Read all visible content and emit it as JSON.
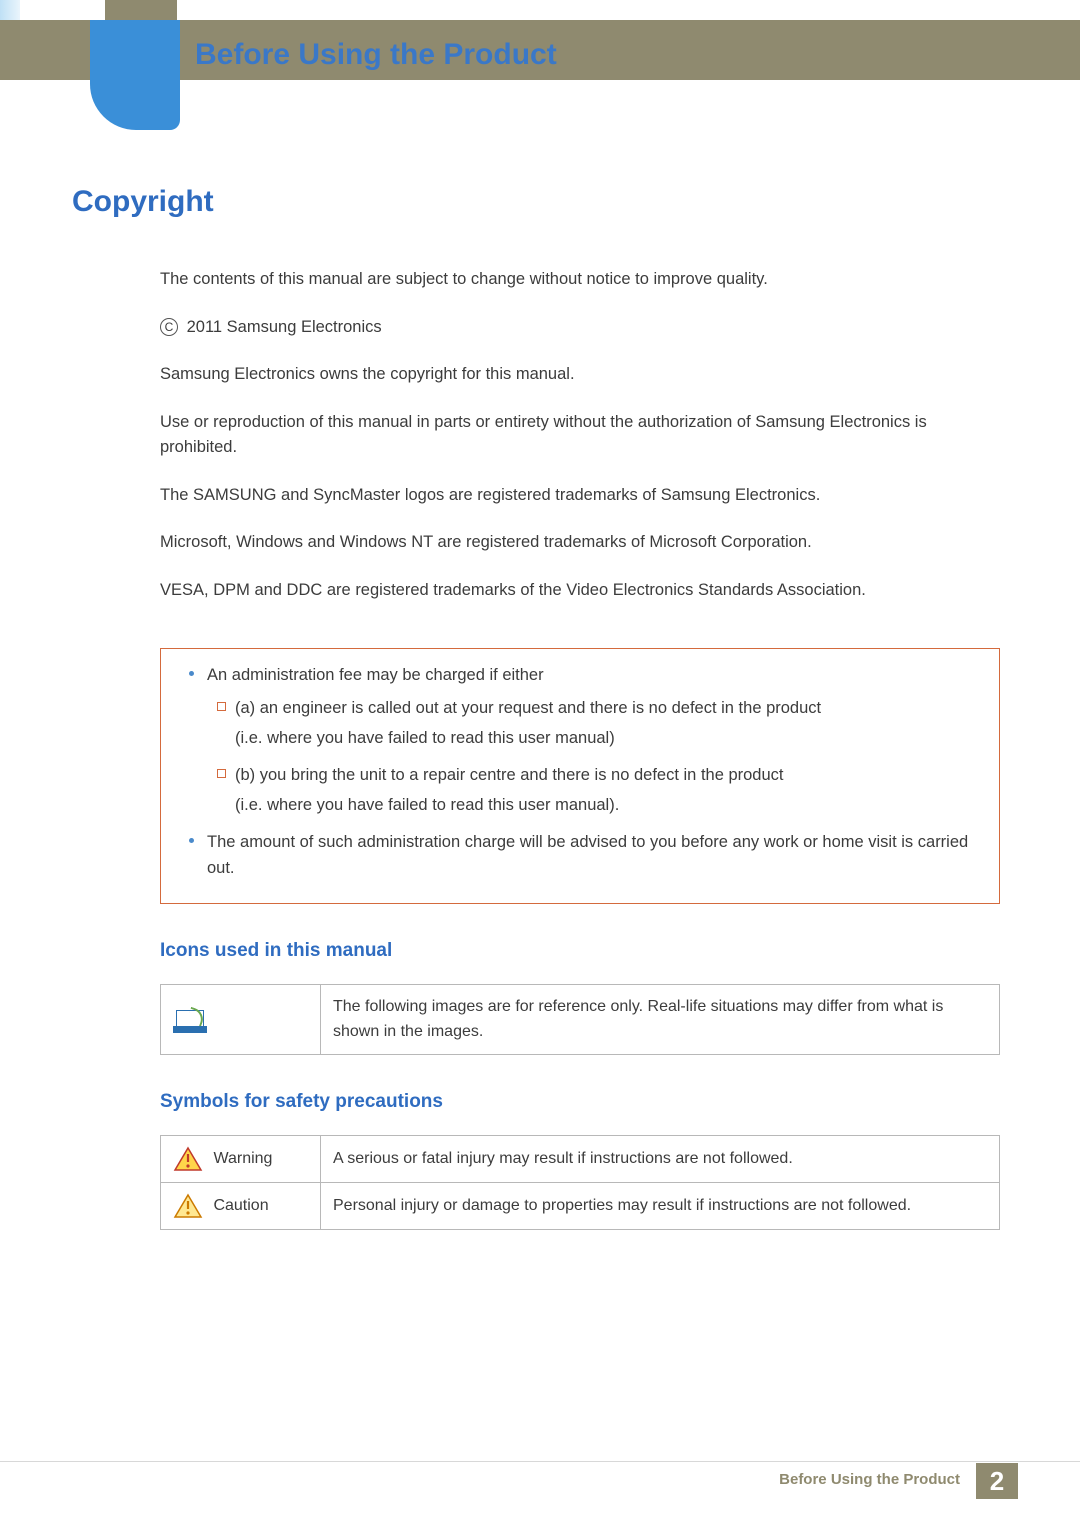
{
  "chapter_title": "Before Using the Product",
  "section_heading": "Copyright",
  "paragraphs": {
    "p1": "The contents of this manual are subject to change without notice to improve quality.",
    "copyright_line": "2011 Samsung Electronics",
    "p2": "Samsung Electronics owns the copyright for this manual.",
    "p3": "Use or reproduction of this manual in parts or entirety without the authorization of Samsung Electronics is prohibited.",
    "p4": "The SAMSUNG and SyncMaster logos are registered trademarks of Samsung Electronics.",
    "p5": "Microsoft, Windows and Windows NT are registered trademarks of Microsoft Corporation.",
    "p6": "VESA, DPM and DDC are registered trademarks of the Video Electronics Standards Association."
  },
  "notice": {
    "t1": "An administration fee may be charged if either",
    "a1": "(a) an engineer is called out at your request and there is no defect in the product",
    "a1b": "(i.e. where you have failed to read this user manual)",
    "b1": "(b) you bring the unit to a repair centre and there is no defect in the product",
    "b1b": "(i.e. where you have failed to read this user manual).",
    "t2": "The amount of such administration charge will be advised to you before any work or home visit is carried out."
  },
  "subsections": {
    "icons_heading": "Icons used in this manual",
    "icons_desc": "The following images are for reference only. Real-life situations may differ from what is shown in the images.",
    "symbols_heading": "Symbols for safety precautions"
  },
  "symbols_table": {
    "warning_label": "Warning",
    "warning_desc": "A serious or fatal injury may result if instructions are not followed.",
    "caution_label": "Caution",
    "caution_desc": "Personal injury or damage to properties may result if instructions are not followed."
  },
  "footer": {
    "text": "Before Using the Product",
    "page_number": "2"
  },
  "colors": {
    "accent_blue": "#2f6cc0",
    "header_olive": "#8f8a6f",
    "badge_blue": "#3a8fd8",
    "notice_border": "#d46a3d"
  }
}
